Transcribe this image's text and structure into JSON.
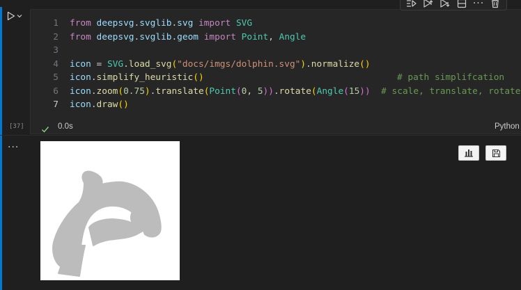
{
  "cell": {
    "lines": [
      {
        "n": "1",
        "tokens": [
          [
            "kw",
            "from"
          ],
          [
            "pl",
            " "
          ],
          [
            "id",
            "deepsvg"
          ],
          [
            "pl",
            "."
          ],
          [
            "id",
            "svglib"
          ],
          [
            "pl",
            "."
          ],
          [
            "id",
            "svg"
          ],
          [
            "pl",
            " "
          ],
          [
            "kw",
            "import"
          ],
          [
            "pl",
            " "
          ],
          [
            "cls",
            "SVG"
          ]
        ]
      },
      {
        "n": "2",
        "tokens": [
          [
            "kw",
            "from"
          ],
          [
            "pl",
            " "
          ],
          [
            "id",
            "deepsvg"
          ],
          [
            "pl",
            "."
          ],
          [
            "id",
            "svglib"
          ],
          [
            "pl",
            "."
          ],
          [
            "id",
            "geom"
          ],
          [
            "pl",
            " "
          ],
          [
            "kw",
            "import"
          ],
          [
            "pl",
            " "
          ],
          [
            "cls",
            "Point"
          ],
          [
            "pl",
            ", "
          ],
          [
            "cls",
            "Angle"
          ]
        ]
      },
      {
        "n": "3",
        "tokens": []
      },
      {
        "n": "4",
        "tokens": [
          [
            "id",
            "icon"
          ],
          [
            "pl",
            " = "
          ],
          [
            "cls",
            "SVG"
          ],
          [
            "pl",
            "."
          ],
          [
            "fn",
            "load_svg"
          ],
          [
            "b1",
            "("
          ],
          [
            "str",
            "\"docs/imgs/dolphin.svg\""
          ],
          [
            "b1",
            ")"
          ],
          [
            "pl",
            "."
          ],
          [
            "fn",
            "normalize"
          ],
          [
            "b1",
            "()"
          ]
        ]
      },
      {
        "n": "5",
        "tokens": [
          [
            "id",
            "icon"
          ],
          [
            "pl",
            "."
          ],
          [
            "fn",
            "simplify_heuristic"
          ],
          [
            "b1",
            "()"
          ],
          [
            "pl",
            "                                    "
          ],
          [
            "cmt",
            "# path simplifcation"
          ]
        ]
      },
      {
        "n": "6",
        "tokens": [
          [
            "id",
            "icon"
          ],
          [
            "pl",
            "."
          ],
          [
            "fn",
            "zoom"
          ],
          [
            "b1",
            "("
          ],
          [
            "num",
            "0.75"
          ],
          [
            "b1",
            ")"
          ],
          [
            "pl",
            "."
          ],
          [
            "fn",
            "translate"
          ],
          [
            "b1",
            "("
          ],
          [
            "cls",
            "Point"
          ],
          [
            "b2",
            "("
          ],
          [
            "num",
            "0"
          ],
          [
            "pl",
            ", "
          ],
          [
            "num",
            "5"
          ],
          [
            "b2",
            "))"
          ],
          [
            "pl",
            "."
          ],
          [
            "fn",
            "rotate"
          ],
          [
            "b1",
            "("
          ],
          [
            "cls",
            "Angle"
          ],
          [
            "b2",
            "("
          ],
          [
            "num",
            "15"
          ],
          [
            "b2",
            "))"
          ],
          [
            "pl",
            "  "
          ],
          [
            "cmt",
            "# scale, translate, rotate"
          ]
        ]
      },
      {
        "n": "7",
        "tokens": [
          [
            "id",
            "icon"
          ],
          [
            "pl",
            "."
          ],
          [
            "fn",
            "draw"
          ],
          [
            "b1",
            "()"
          ]
        ]
      }
    ],
    "active_line": "7",
    "exec_count": "[37]",
    "exec_time": "0.0s",
    "language": "Python"
  },
  "icons": {
    "run": "run-icon",
    "run_menu": "chevron-down-icon",
    "toolbar": [
      "run-by-line-icon",
      "execute-above-icon",
      "execute-below-icon",
      "split-cell-icon",
      "more-icon",
      "delete-icon"
    ],
    "status": "check-icon",
    "output_more": "more-icon",
    "output_buttons": [
      "chart-icon",
      "save-icon"
    ]
  },
  "colors": {
    "accent": "#0078d4",
    "background": "#1f1f1f",
    "editor_bg": "#262626",
    "success": "#89d185",
    "dolphin_fill": "#bcbcbc"
  },
  "output": {
    "more_label": "...",
    "image_alt": "dolphin"
  }
}
